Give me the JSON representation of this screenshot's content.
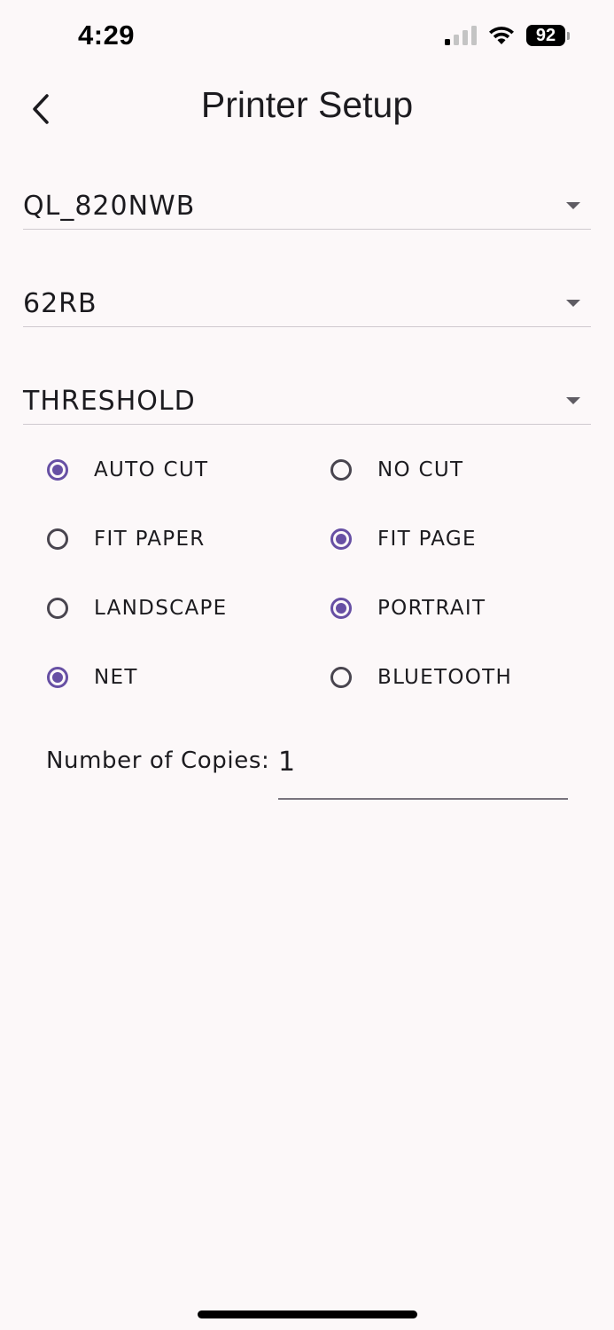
{
  "status_bar": {
    "time": "4:29",
    "battery": "92",
    "icons": [
      "signal-icon",
      "wifi-icon",
      "battery-icon"
    ]
  },
  "header": {
    "title": "Printer Setup",
    "back_icon": "chevron-left-icon"
  },
  "dropdowns": {
    "printer_model": "QL_820NWB",
    "label_size": "62RB",
    "mode": "THRESHOLD"
  },
  "options": [
    {
      "label": "AUTO CUT",
      "checked": true
    },
    {
      "label": "NO CUT",
      "checked": false
    },
    {
      "label": "FIT PAPER",
      "checked": false
    },
    {
      "label": "FIT PAGE",
      "checked": true
    },
    {
      "label": "LANDSCAPE",
      "checked": false
    },
    {
      "label": "PORTRAIT",
      "checked": true
    },
    {
      "label": "NET",
      "checked": true
    },
    {
      "label": "BLUETOOTH",
      "checked": false
    }
  ],
  "copies": {
    "label": "Number of Copies:",
    "value": "1"
  },
  "colors": {
    "accent": "#6750a4",
    "background": "#fcf8f9",
    "text": "#1c1b1f"
  }
}
